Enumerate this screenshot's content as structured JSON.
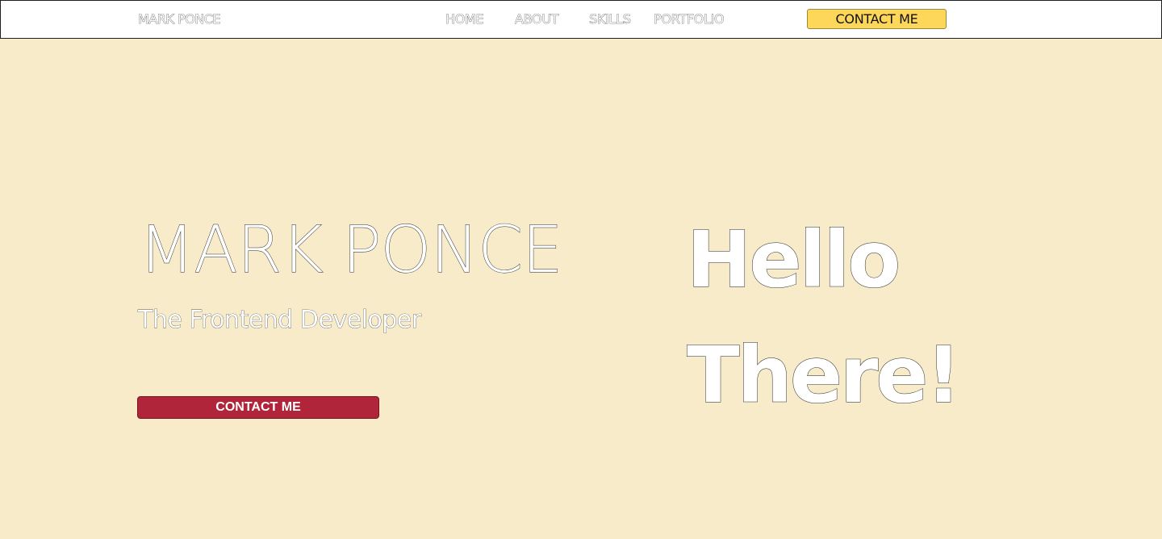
{
  "nav": {
    "brand": "MARK PONCE",
    "links": [
      "HOME",
      "ABOUT",
      "SKILLS",
      "PORTFOLIO"
    ],
    "contact_label": "CONTACT ME"
  },
  "hero": {
    "name": "MARK PONCE",
    "role": "The Frontend Developer",
    "cta_label": "CONTACT ME",
    "greeting_line1": "Hello",
    "greeting_line2": "There!"
  },
  "colors": {
    "page_background": "#f7ebc9",
    "nav_background": "#ffffff",
    "nav_contact_button": "#fdd75a",
    "hero_cta_button": "#b02539"
  }
}
